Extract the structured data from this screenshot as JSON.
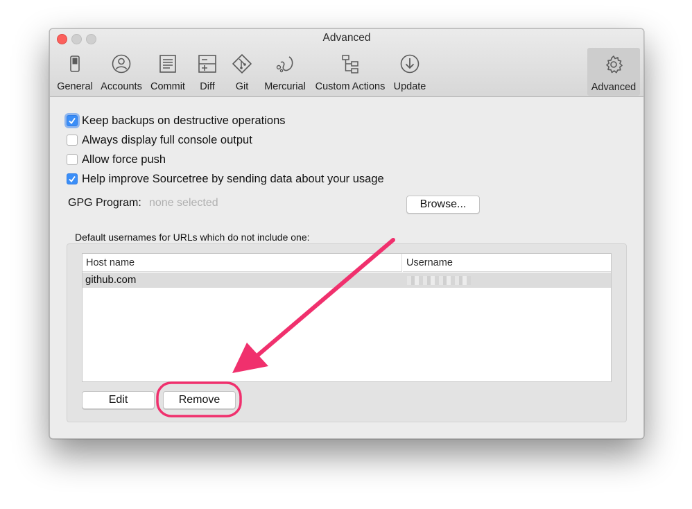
{
  "window": {
    "title": "Advanced"
  },
  "toolbar": {
    "items": [
      {
        "label": "General",
        "icon": "general-switch-icon"
      },
      {
        "label": "Accounts",
        "icon": "accounts-icon"
      },
      {
        "label": "Commit",
        "icon": "commit-icon"
      },
      {
        "label": "Diff",
        "icon": "diff-icon"
      },
      {
        "label": "Git",
        "icon": "git-icon"
      },
      {
        "label": "Mercurial",
        "icon": "mercurial-icon"
      },
      {
        "label": "Custom Actions",
        "icon": "custom-actions-icon"
      },
      {
        "label": "Update",
        "icon": "update-icon"
      },
      {
        "label": "Advanced",
        "icon": "gear-icon",
        "selected": true
      }
    ]
  },
  "options": [
    {
      "label": "Keep backups on destructive operations",
      "checked": true
    },
    {
      "label": "Always display full console output",
      "checked": false
    },
    {
      "label": "Allow force push",
      "checked": false
    },
    {
      "label": "Help improve Sourcetree by sending data about your usage",
      "checked": true
    }
  ],
  "gpg": {
    "label": "GPG Program:",
    "value": "none selected",
    "browse_label": "Browse..."
  },
  "usernames": {
    "group_label": "Default usernames for URLs which do not include one:",
    "columns": [
      "Host name",
      "Username"
    ],
    "rows": [
      {
        "host": "github.com",
        "username": ""
      }
    ],
    "edit_label": "Edit",
    "remove_label": "Remove"
  },
  "colors": {
    "accent": "#3b8ef7",
    "annotation": "#f0306d",
    "close": "#fc605c"
  }
}
